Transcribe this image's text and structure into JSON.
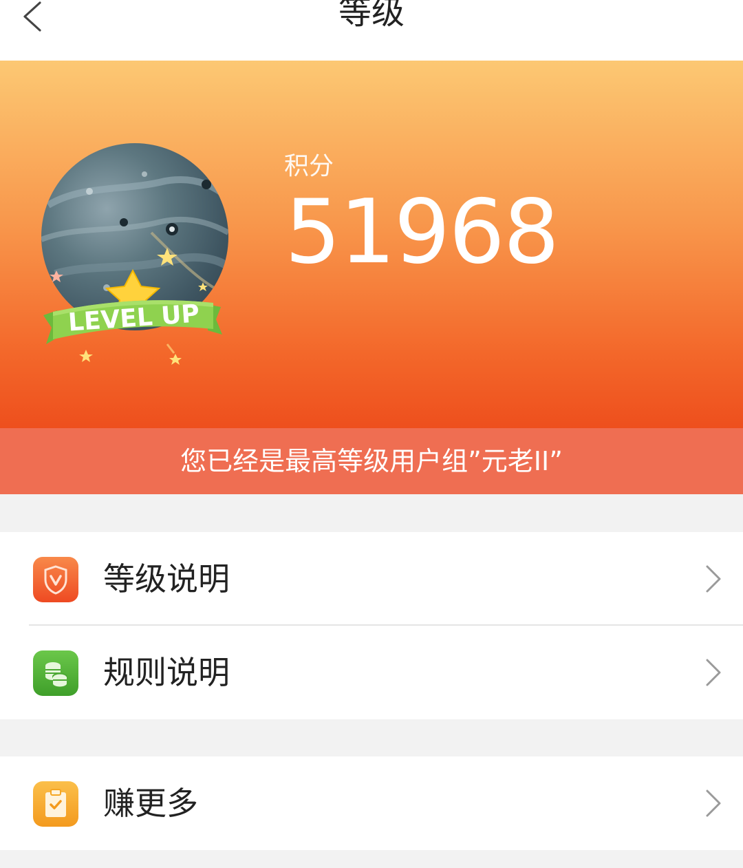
{
  "header": {
    "title": "等级",
    "back_icon": "chevron-left-icon"
  },
  "hero": {
    "score_label": "积分",
    "score_value": "51968",
    "badge_text": "LEVEL UP",
    "gradient_top": "#fcc873",
    "gradient_bottom": "#ee4f1d"
  },
  "status": {
    "message": "您已经是最高等级用户组”元老II”",
    "color": "#ef6e52"
  },
  "menu": {
    "items": [
      {
        "label": "等级说明",
        "icon": "shield-v-icon",
        "color": "#f2622f"
      },
      {
        "label": "规则说明",
        "icon": "coins-icon",
        "color": "#4caf3a"
      }
    ]
  },
  "earn": {
    "label": "赚更多",
    "icon": "clipboard-check-icon",
    "color": "#f5a623"
  }
}
